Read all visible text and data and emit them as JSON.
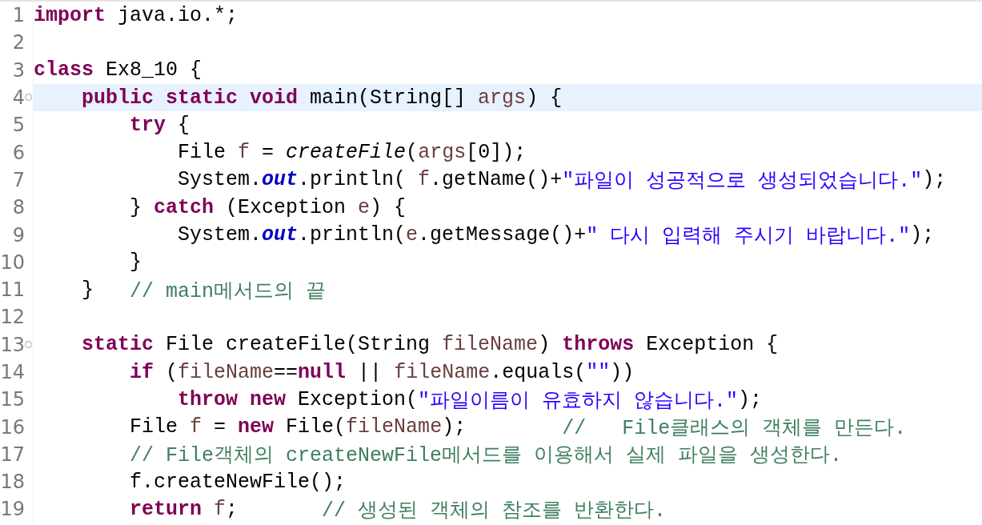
{
  "editor": {
    "lines": [
      {
        "number": "1",
        "highlighted": false,
        "fold": false,
        "tokens": [
          {
            "kind": "kw",
            "text": "import"
          },
          {
            "kind": "plain",
            "text": " java.io.*;"
          }
        ]
      },
      {
        "number": "2",
        "highlighted": false,
        "fold": false
      },
      {
        "number": "3",
        "highlighted": false,
        "fold": false,
        "tokens": [
          {
            "kind": "kw",
            "text": "class"
          },
          {
            "kind": "plain",
            "text": " Ex8_10 {"
          }
        ]
      },
      {
        "number": "4",
        "highlighted": true,
        "fold": true,
        "tokens": [
          {
            "kind": "kw",
            "text": "    public static void"
          },
          {
            "kind": "plain",
            "text": " main(String[] "
          },
          {
            "kind": "var",
            "text": "args"
          },
          {
            "kind": "plain",
            "text": ") {"
          }
        ]
      },
      {
        "number": "5",
        "highlighted": false,
        "fold": false,
        "tokens": [
          {
            "kind": "kw",
            "text": "        try"
          },
          {
            "kind": "plain",
            "text": " {"
          }
        ]
      },
      {
        "number": "6",
        "highlighted": false,
        "fold": false,
        "tokens": [
          {
            "kind": "plain",
            "text": "            File "
          },
          {
            "kind": "var",
            "text": "f"
          },
          {
            "kind": "plain",
            "text": " = "
          },
          {
            "kind": "static",
            "text": "createFile"
          },
          {
            "kind": "plain",
            "text": "("
          },
          {
            "kind": "var",
            "text": "args"
          },
          {
            "kind": "plain",
            "text": "[0]);"
          }
        ]
      },
      {
        "number": "7",
        "highlighted": false,
        "fold": false,
        "tokens": [
          {
            "kind": "plain",
            "text": "            System."
          },
          {
            "kind": "field",
            "text": "out"
          },
          {
            "kind": "plain",
            "text": ".println( "
          },
          {
            "kind": "var",
            "text": "f"
          },
          {
            "kind": "plain",
            "text": ".getName()+"
          },
          {
            "kind": "str",
            "text": "\"파일이 성공적으로 생성되었습니다.\""
          },
          {
            "kind": "plain",
            "text": ");"
          }
        ]
      },
      {
        "number": "8",
        "highlighted": false,
        "fold": false,
        "tokens": [
          {
            "kind": "plain",
            "text": "        } "
          },
          {
            "kind": "kw",
            "text": "catch"
          },
          {
            "kind": "plain",
            "text": " (Exception "
          },
          {
            "kind": "var",
            "text": "e"
          },
          {
            "kind": "plain",
            "text": ") {"
          }
        ]
      },
      {
        "number": "9",
        "highlighted": false,
        "fold": false,
        "tokens": [
          {
            "kind": "plain",
            "text": "            System."
          },
          {
            "kind": "field",
            "text": "out"
          },
          {
            "kind": "plain",
            "text": ".println("
          },
          {
            "kind": "var",
            "text": "e"
          },
          {
            "kind": "plain",
            "text": ".getMessage()+"
          },
          {
            "kind": "str",
            "text": "\" 다시 입력해 주시기 바랍니다.\""
          },
          {
            "kind": "plain",
            "text": ");"
          }
        ]
      },
      {
        "number": "10",
        "highlighted": false,
        "fold": false,
        "tokens": [
          {
            "kind": "plain",
            "text": "        }"
          }
        ]
      },
      {
        "number": "11",
        "highlighted": false,
        "fold": false,
        "tokens": [
          {
            "kind": "plain",
            "text": "    }   "
          },
          {
            "kind": "cmt",
            "text": "// main메서드의 끝"
          }
        ]
      },
      {
        "number": "12",
        "highlighted": false,
        "fold": false
      },
      {
        "number": "13",
        "highlighted": false,
        "fold": true,
        "tokens": [
          {
            "kind": "kw",
            "text": "    static"
          },
          {
            "kind": "plain",
            "text": " File createFile(String "
          },
          {
            "kind": "var",
            "text": "fileName"
          },
          {
            "kind": "plain",
            "text": ") "
          },
          {
            "kind": "kw",
            "text": "throws"
          },
          {
            "kind": "plain",
            "text": " Exception {"
          }
        ]
      },
      {
        "number": "14",
        "highlighted": false,
        "fold": false,
        "tokens": [
          {
            "kind": "kw",
            "text": "        if"
          },
          {
            "kind": "plain",
            "text": " ("
          },
          {
            "kind": "var",
            "text": "fileName"
          },
          {
            "kind": "plain",
            "text": "=="
          },
          {
            "kind": "kw",
            "text": "null"
          },
          {
            "kind": "plain",
            "text": " || "
          },
          {
            "kind": "var",
            "text": "fileName"
          },
          {
            "kind": "plain",
            "text": ".equals("
          },
          {
            "kind": "str",
            "text": "\"\""
          },
          {
            "kind": "plain",
            "text": "))"
          }
        ]
      },
      {
        "number": "15",
        "highlighted": false,
        "fold": false,
        "tokens": [
          {
            "kind": "kw",
            "text": "            throw new"
          },
          {
            "kind": "plain",
            "text": " Exception("
          },
          {
            "kind": "str",
            "text": "\"파일이름이 유효하지 않습니다.\""
          },
          {
            "kind": "plain",
            "text": ");"
          }
        ]
      },
      {
        "number": "16",
        "highlighted": false,
        "fold": false,
        "tokens": [
          {
            "kind": "plain",
            "text": "        File "
          },
          {
            "kind": "var",
            "text": "f"
          },
          {
            "kind": "plain",
            "text": " = "
          },
          {
            "kind": "kw",
            "text": "new"
          },
          {
            "kind": "plain",
            "text": " File("
          },
          {
            "kind": "var",
            "text": "fileName"
          },
          {
            "kind": "plain",
            "text": ");        "
          },
          {
            "kind": "cmt",
            "text": "//   File클래스의 객체를 만든다."
          }
        ]
      },
      {
        "number": "17",
        "highlighted": false,
        "fold": false,
        "tokens": [
          {
            "kind": "cmt",
            "text": "        // File객체의 createNewFile메서드를 이용해서 실제 파일을 생성한다."
          }
        ]
      },
      {
        "number": "18",
        "highlighted": false,
        "fold": false,
        "tokens": [
          {
            "kind": "plain",
            "text": "        f.createNewFile();"
          }
        ]
      },
      {
        "number": "19",
        "highlighted": false,
        "fold": false,
        "tokens": [
          {
            "kind": "kw",
            "text": "        return"
          },
          {
            "kind": "var",
            "text": " f"
          },
          {
            "kind": "plain",
            "text": ";       "
          },
          {
            "kind": "cmt",
            "text": "// 생성된 객체의 참조를 반환한다."
          }
        ]
      }
    ]
  }
}
